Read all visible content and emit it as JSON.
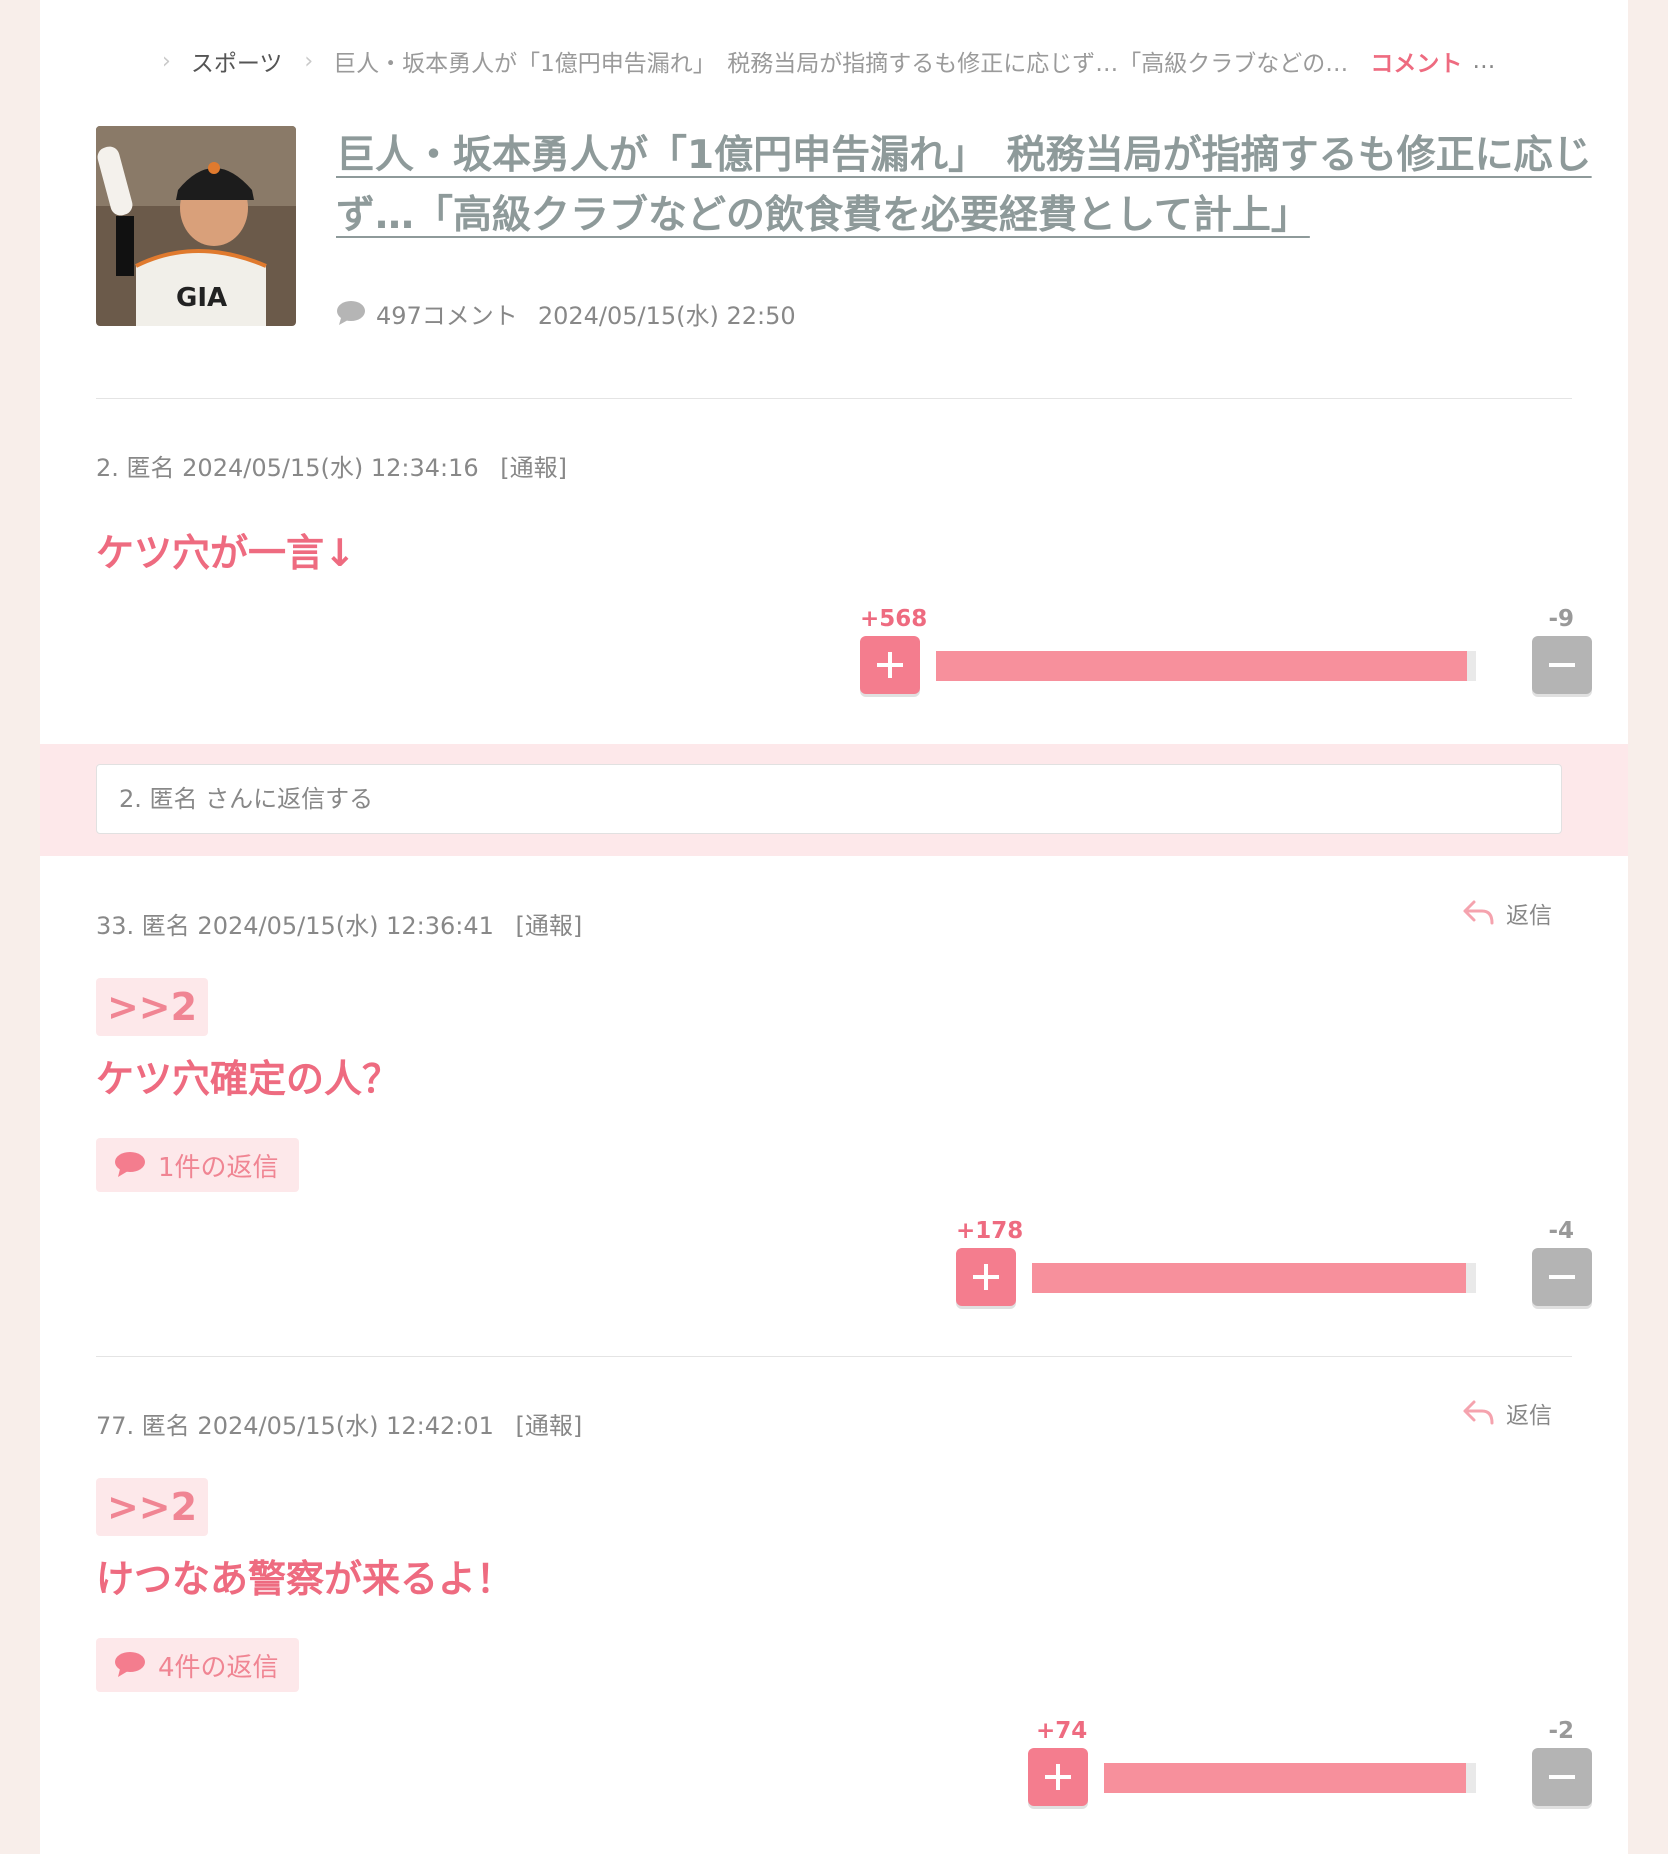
{
  "breadcrumb": {
    "home": "スポーツ",
    "article": "巨人・坂本勇人が「1億円申告漏れ」　税務当局が指摘するも修正に応じず…「高級クラブなどの…",
    "current": "コメント",
    "more": "…"
  },
  "article": {
    "title": "巨人・坂本勇人が「1億円申告漏れ」　税務当局が指摘するも修正に応じず…「高級クラブなどの飲食費を必要経費として計上」",
    "comment_count": "497コメント",
    "datetime": "2024/05/15(水) 22:50",
    "thumbnail_text": "GIA"
  },
  "reply_prompt": {
    "placeholder": "2. 匿名 さんに返信する"
  },
  "comments": [
    {
      "meta": "2. 匿名 2024/05/15(水) 12:34:16",
      "report": "[通報]",
      "body": "ケツ穴が一言↓",
      "plus": "+568",
      "minus": "-9",
      "plus_ratio": 0.984
    },
    {
      "meta": "33. 匿名 2024/05/15(水) 12:36:41",
      "report": "[通報]",
      "reply_label": "返信",
      "anchor": ">>2",
      "body": "ケツ穴確定の人？",
      "replies": "1件の返信",
      "plus": "+178",
      "minus": "-4",
      "plus_ratio": 0.978
    },
    {
      "meta": "77. 匿名 2024/05/15(水) 12:42:01",
      "report": "[通報]",
      "reply_label": "返信",
      "anchor": ">>2",
      "body": "けつなあ警察が来るよ！",
      "replies": "4件の返信",
      "plus": "+74",
      "minus": "-2",
      "plus_ratio": 0.974
    }
  ],
  "colors": {
    "accent": "#ee6b80",
    "bar_fill": "#f7909c",
    "minus_btn": "#b4b4b4",
    "pink_bg": "#fde8ea"
  }
}
